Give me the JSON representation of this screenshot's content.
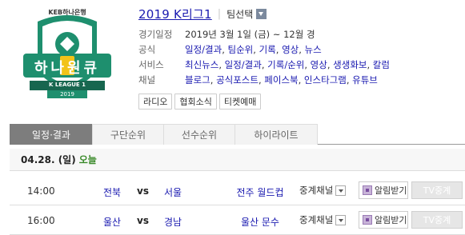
{
  "league": {
    "title": "2019 K리그1",
    "team_select_label": "팀선택"
  },
  "logo": {
    "sponsor": "KEB하나은행",
    "main": "하나원큐",
    "sub": "K LEAGUE 1",
    "year": "2019"
  },
  "info": {
    "period_label": "경기일정",
    "period_value": "2019년 3월 1일 (금) ~ 12월 경",
    "official_label": "공식",
    "official_links": [
      "일정/결과",
      "팀순위",
      "기록",
      "영상",
      "뉴스"
    ],
    "service_label": "서비스",
    "service_links": [
      "최신뉴스",
      "일정/결과",
      "기록/순위",
      "영상",
      "생생화보",
      "칼럼"
    ],
    "channel_label": "채널",
    "channel_links": [
      "블로그",
      "공식포스트",
      "페이스북",
      "인스타그램",
      "유튜브"
    ]
  },
  "buttons": [
    "라디오",
    "협회소식",
    "티켓예매"
  ],
  "tabs": [
    "일정·결과",
    "구단순위",
    "선수순위",
    "하이라이트"
  ],
  "day": {
    "date": "04.28. (일)",
    "today_label": "오늘"
  },
  "matches": [
    {
      "time": "14:00",
      "home": "전북",
      "vs": "vs",
      "away": "서울",
      "venue": "전주 월드컵",
      "channel": "중계채널",
      "alarm": "알림받기",
      "tv": "TV중계"
    },
    {
      "time": "16:00",
      "home": "울산",
      "vs": "vs",
      "away": "경남",
      "venue": "울산 문수",
      "channel": "중계채널",
      "alarm": "알림받기",
      "tv": "TV중계"
    }
  ],
  "colors": {
    "link": "#1a1ab0",
    "active_tab": "#7d7d7d",
    "today": "#3a8a2a",
    "logo_green": "#1e8f6e"
  }
}
